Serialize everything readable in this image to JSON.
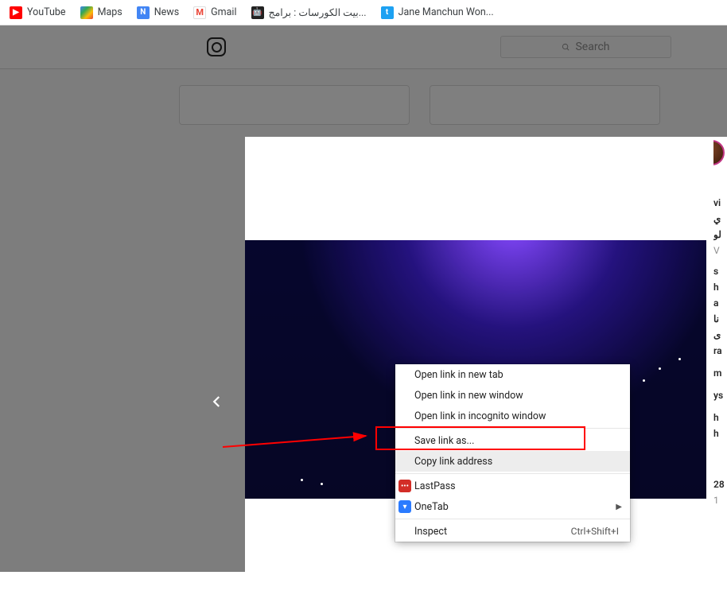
{
  "bookmarks": [
    {
      "label": "YouTube",
      "icon": "yt"
    },
    {
      "label": "Maps",
      "icon": "maps"
    },
    {
      "label": "News",
      "icon": "news"
    },
    {
      "label": "Gmail",
      "icon": "gmail"
    },
    {
      "label": "بيت الكورسات : برامج...",
      "icon": "ar"
    },
    {
      "label": "Jane Manchun Won...",
      "icon": "tw"
    }
  ],
  "search": {
    "placeholder": "Search"
  },
  "context_menu": {
    "items": [
      {
        "label": "Open link in new tab"
      },
      {
        "label": "Open link in new window"
      },
      {
        "label": "Open link in incognito window"
      }
    ],
    "save_as": "Save link as...",
    "copy_link": "Copy link address",
    "lastpass": "LastPass",
    "onetab": "OneTab",
    "inspect": "Inspect",
    "inspect_shortcut": "Ctrl+Shift+I"
  },
  "right_col": {
    "lines": [
      "vi",
      "ي",
      "لو",
      "V",
      "s",
      "h",
      "a",
      "نا",
      "ى",
      "ra",
      "m",
      "ys",
      "h",
      "h",
      "28",
      "1"
    ]
  }
}
